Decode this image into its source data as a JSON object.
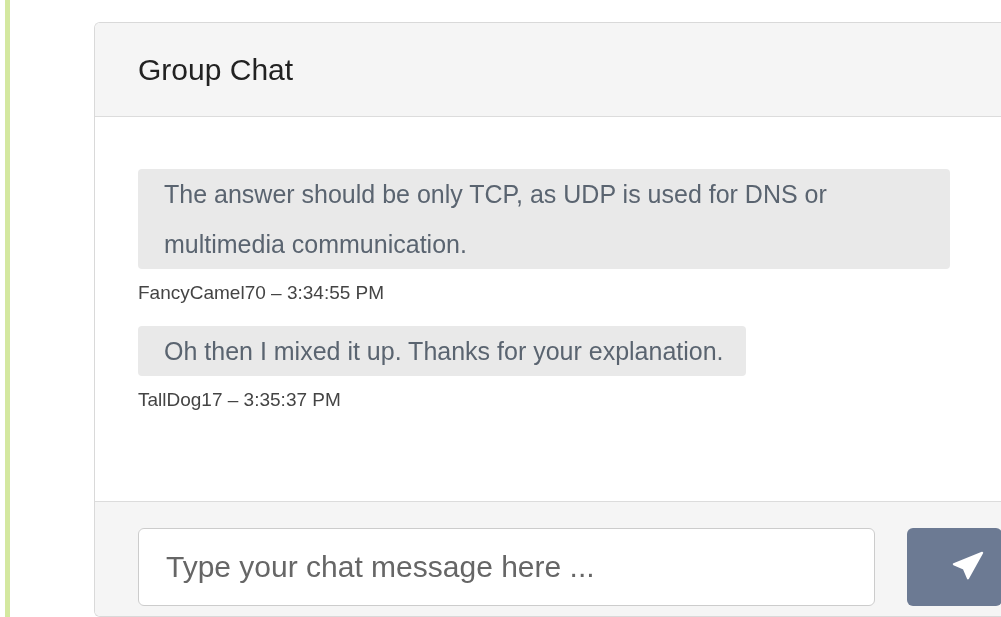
{
  "chat": {
    "title": "Group Chat",
    "messages": [
      {
        "text": "The answer should be only TCP, as UDP is used for DNS or multimedia communication.",
        "meta": "FancyCamel70 – 3:34:55 PM"
      },
      {
        "text": "Oh then I mixed it up. Thanks for your explanation.",
        "meta": "TallDog17 – 3:35:37 PM"
      }
    ],
    "input": {
      "placeholder": "Type your chat message here ..."
    }
  }
}
